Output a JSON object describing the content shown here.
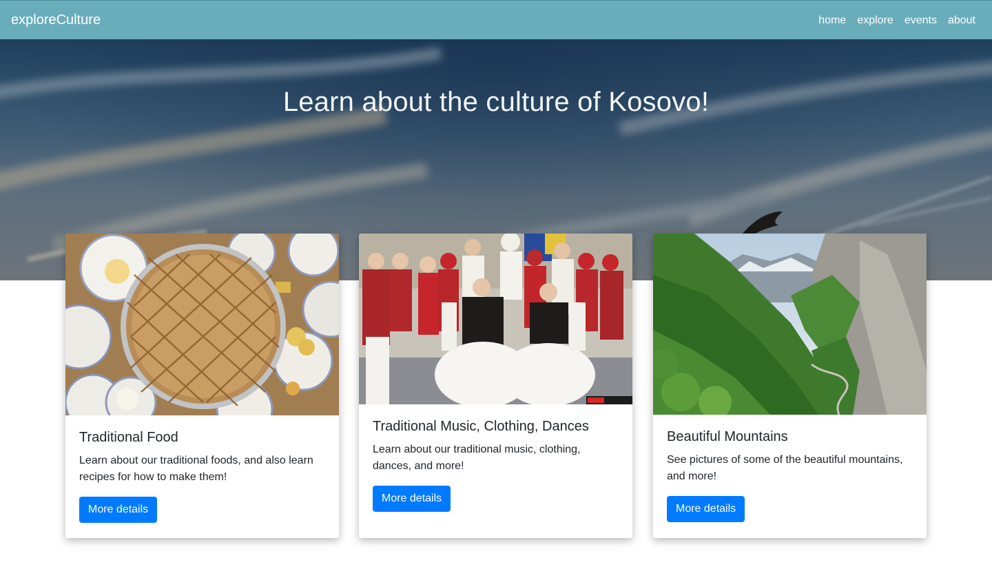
{
  "navbar": {
    "brand": "exploreCulture",
    "links": [
      "home",
      "explore",
      "events",
      "about"
    ]
  },
  "hero": {
    "title": "Learn about the culture of Kosovo!"
  },
  "cards": [
    {
      "title": "Traditional Food",
      "text": "Learn about our traditional foods, and also learn recipes for how to make them!",
      "button": "More details",
      "image": "flija-pie-photo"
    },
    {
      "title": "Traditional Music, Clothing, Dances",
      "text": "Learn about our traditional music, clothing, dances, and more!",
      "button": "More details",
      "image": "folk-dancers-photo"
    },
    {
      "title": "Beautiful Mountains",
      "text": "See pictures of some of the beautiful mountains, and more!",
      "button": "More details",
      "image": "mountain-valley-photo"
    }
  ],
  "colors": {
    "navbar": "#69adbb",
    "button": "#007bff",
    "text": "#212529"
  }
}
